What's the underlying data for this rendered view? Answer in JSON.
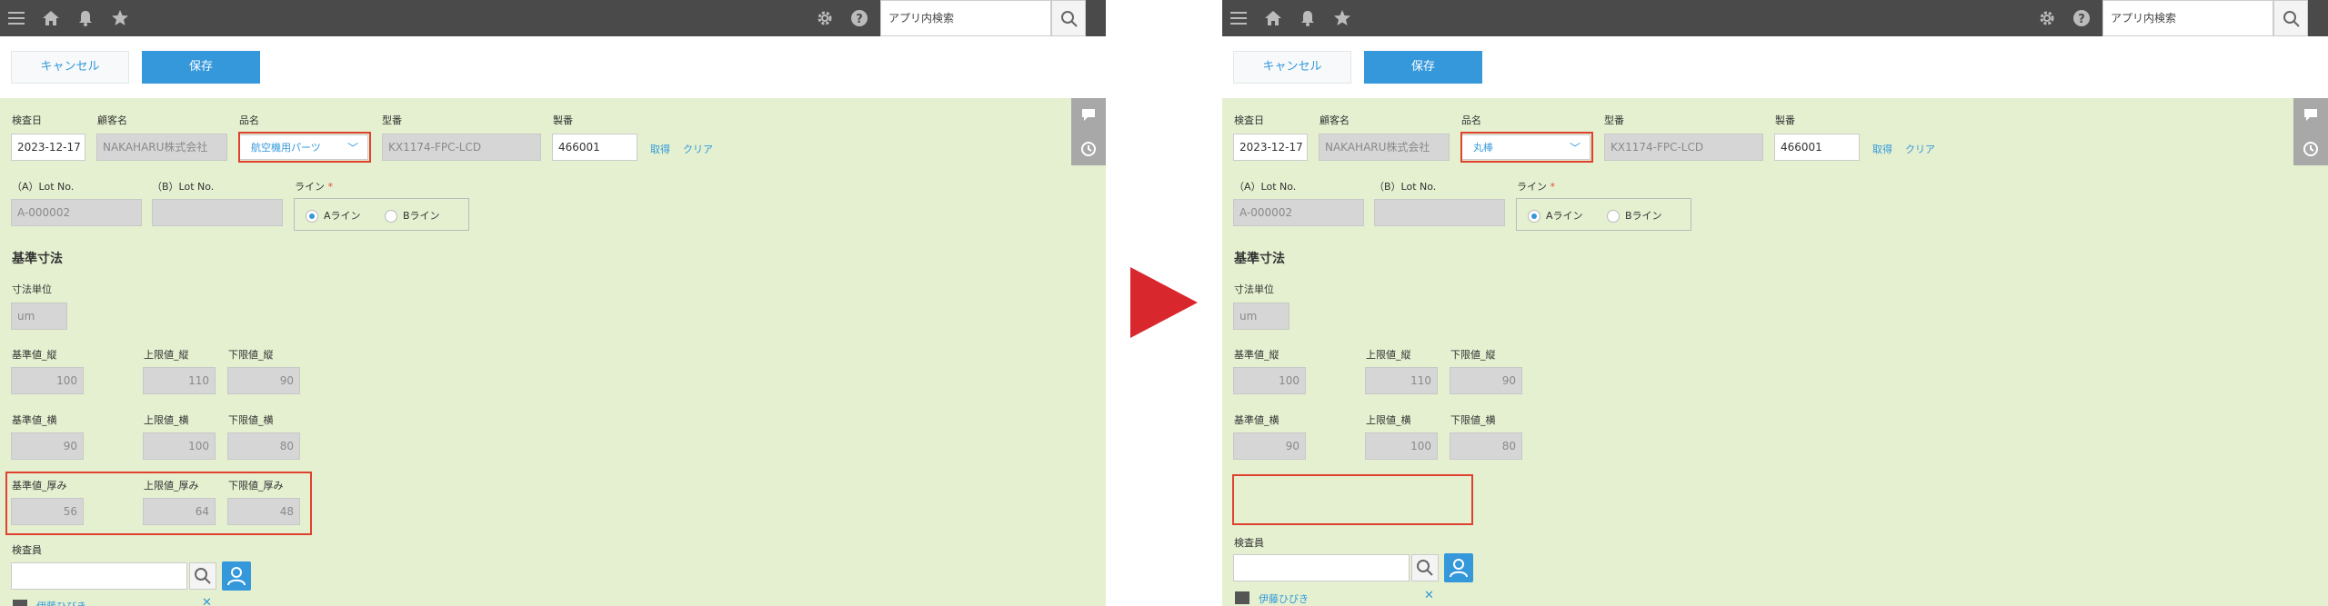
{
  "header": {
    "search_placeholder": "アプリ内検索"
  },
  "actions": {
    "cancel_label": "キャンセル",
    "save_label": "保存"
  },
  "labels": {
    "inspection_date": "検査日",
    "customer_name": "顧客名",
    "product_name": "品名",
    "model_no": "型番",
    "serial_no": "製番",
    "lot_a": "（A）Lot No.",
    "lot_b": "（B）Lot No.",
    "line": "ライン",
    "required_mark": "*",
    "section_title": "基準寸法",
    "unit_label": "寸法単位",
    "base_vertical": "基準値_縦",
    "upper_vertical": "上限値_縦",
    "lower_vertical": "下限値_縦",
    "base_horizontal": "基準値_横",
    "upper_horizontal": "上限値_横",
    "lower_horizontal": "下限値_横",
    "base_thickness": "基準値_厚み",
    "upper_thickness": "上限値_厚み",
    "lower_thickness": "下限値_厚み",
    "inspector": "検査員",
    "fetch_link": "取得",
    "clear_link": "クリア",
    "line_a": "Aライン",
    "line_b": "Bライン"
  },
  "before": {
    "inspection_date": "2023-12-17",
    "customer_name": "NAKAHARU株式会社",
    "product_name": "航空機用パーツ",
    "model_no": "KX1174-FPC-LCD",
    "serial_no": "466001",
    "lot_a": "A-000002",
    "lot_b": "",
    "unit": "um",
    "base_vertical": "100",
    "upper_vertical": "110",
    "lower_vertical": "90",
    "base_horizontal": "90",
    "upper_horizontal": "100",
    "lower_horizontal": "80",
    "base_thickness": "56",
    "upper_thickness": "64",
    "lower_thickness": "48",
    "inspector_name": "伊藤ひびき"
  },
  "after": {
    "inspection_date": "2023-12-17",
    "customer_name": "NAKAHARU株式会社",
    "product_name": "丸棒",
    "model_no": "KX1174-FPC-LCD",
    "serial_no": "466001",
    "lot_a": "A-000002",
    "lot_b": "",
    "unit": "um",
    "base_vertical": "100",
    "upper_vertical": "110",
    "lower_vertical": "90",
    "base_horizontal": "90",
    "upper_horizontal": "100",
    "lower_horizontal": "80",
    "inspector_name": "伊藤ひびき"
  },
  "colors": {
    "accent": "#3498db",
    "highlight": "#e0402f",
    "arrow": "#d9272e",
    "form_bg": "#e4f0d0",
    "topbar": "#4a4a4a"
  }
}
